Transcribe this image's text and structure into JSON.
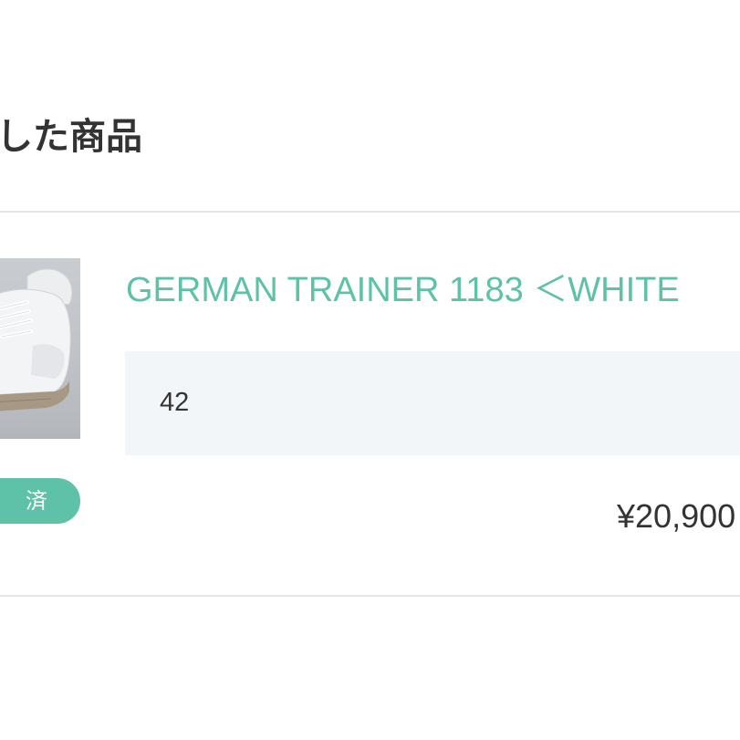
{
  "section": {
    "title": "した商品"
  },
  "item": {
    "name": "GERMAN TRAINER 1183 ＜WHITE",
    "option": "42",
    "price": "¥20,900",
    "status_badge": "済",
    "image_icon": "shoe-thumbnail"
  },
  "colors": {
    "accent": "#5ec2a8",
    "text": "#333333",
    "option_bg": "#f2f6f8",
    "divider": "#e6e6e6"
  }
}
